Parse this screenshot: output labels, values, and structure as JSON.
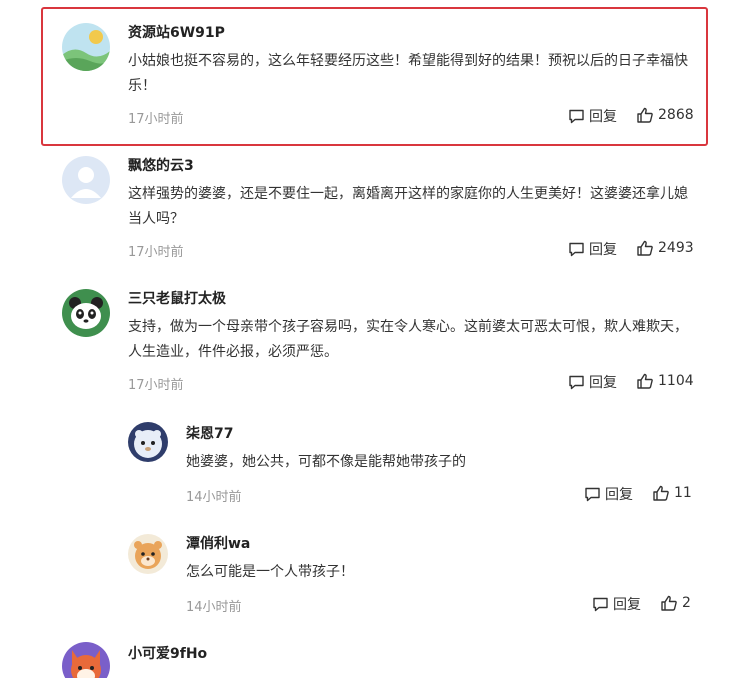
{
  "labels": {
    "reply": "回复"
  },
  "colors": {
    "highlight": "#d9363e",
    "muted": "#999999"
  },
  "comments": [
    {
      "username": "资源站6W91P",
      "content": "小姑娘也挺不容易的，这么年轻要经历这些！希望能得到好的结果！预祝以后的日子幸福快乐！",
      "time": "17小时前",
      "likes": "2868",
      "avatar_icon": "landscape-avatar-icon"
    },
    {
      "username": "飘悠的云3",
      "content": "这样强势的婆婆，还是不要住一起，离婚离开这样的家庭你的人生更美好！这婆婆还拿儿媳当人吗？",
      "time": "17小时前",
      "likes": "2493",
      "avatar_icon": "default-user-avatar-icon"
    },
    {
      "username": "三只老鼠打太极",
      "content": "支持，做为一个母亲带个孩子容易吗，实在令人寒心。这前婆太可恶太可恨，欺人难欺天，人生造业，件件必报，必须严惩。",
      "time": "17小时前",
      "likes": "1104",
      "avatar_icon": "panda-avatar-icon"
    },
    {
      "username": "柒恩77",
      "content": "她婆婆，她公共，可都不像是能帮她带孩子的",
      "time": "14小时前",
      "likes": "11",
      "avatar_icon": "bear-astronaut-avatar-icon"
    },
    {
      "username": "潭俏利wa",
      "content": "怎么可能是一个人带孩子！",
      "time": "14小时前",
      "likes": "2",
      "avatar_icon": "tiger-avatar-icon"
    },
    {
      "username": "小可爱9fHo",
      "content": "",
      "time": "",
      "likes": "",
      "avatar_icon": "fox-avatar-icon"
    }
  ]
}
